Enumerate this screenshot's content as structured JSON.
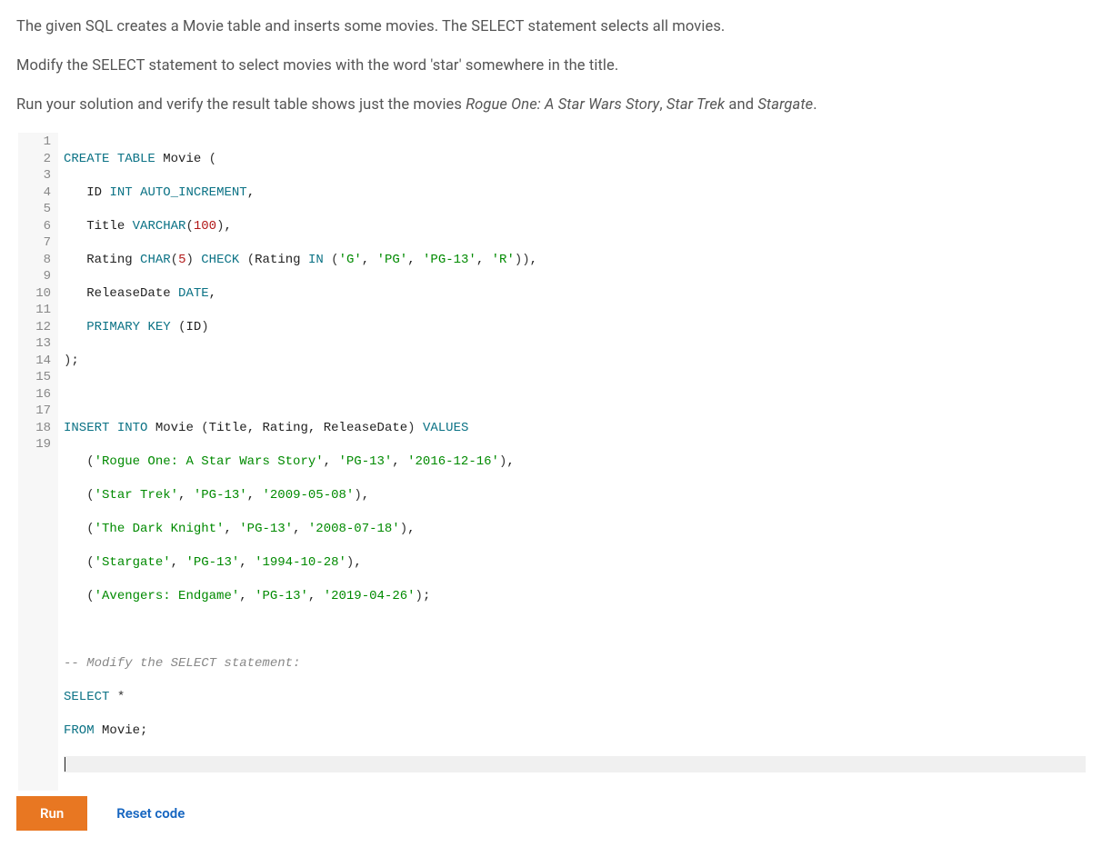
{
  "instructions": {
    "p1": "The given SQL creates a Movie table and inserts some movies. The SELECT statement selects all movies.",
    "p2": "Modify the SELECT statement to select movies with the word 'star' somewhere in the title.",
    "p3_pre": "Run your solution and verify the result table shows just the movies ",
    "p3_em1": "Rogue One: A Star Wars Story",
    "p3_sep1": ", ",
    "p3_em2": "Star Trek",
    "p3_sep2": " and ",
    "p3_em3": "Stargate",
    "p3_post": "."
  },
  "code": {
    "line_count": 19,
    "line1": {
      "kw_create": "CREATE",
      "kw_table": "TABLE",
      "ident": "Movie",
      "open": "("
    },
    "line2": {
      "ident": "ID",
      "type": "INT",
      "kw": "AUTO_INCREMENT",
      "comma": ","
    },
    "line3": {
      "ident": "Title",
      "type": "VARCHAR",
      "open": "(",
      "num": "100",
      "close": ")",
      "comma": ","
    },
    "line4": {
      "ident": "Rating",
      "type": "CHAR",
      "open": "(",
      "num": "5",
      "close": ")",
      "kw_check": "CHECK",
      "open2": "(",
      "ident2": "Rating",
      "kw_in": "IN",
      "open3": "(",
      "s1": "'G'",
      "c1": ",",
      "s2": "'PG'",
      "c2": ",",
      "s3": "'PG-13'",
      "c3": ",",
      "s4": "'R'",
      "close3": ")",
      "close2": ")",
      "comma": ","
    },
    "line5": {
      "ident": "ReleaseDate",
      "type": "DATE",
      "comma": ","
    },
    "line6": {
      "kw_primary": "PRIMARY",
      "kw_key": "KEY",
      "open": "(",
      "ident": "ID",
      "close": ")"
    },
    "line7": {
      "close": ")",
      "semi": ";"
    },
    "line9": {
      "kw_insert": "INSERT",
      "kw_into": "INTO",
      "ident": "Movie",
      "open": "(",
      "c1": "Title",
      "comma1": ",",
      "c2": "Rating",
      "comma2": ",",
      "c3": "ReleaseDate",
      "close": ")",
      "kw_values": "VALUES"
    },
    "line10": {
      "open": "(",
      "s1": "'Rogue One: A Star Wars Story'",
      "c1": ",",
      "s2": "'PG-13'",
      "c2": ",",
      "s3": "'2016-12-16'",
      "close": ")",
      "comma": ","
    },
    "line11": {
      "open": "(",
      "s1": "'Star Trek'",
      "c1": ",",
      "s2": "'PG-13'",
      "c2": ",",
      "s3": "'2009-05-08'",
      "close": ")",
      "comma": ","
    },
    "line12": {
      "open": "(",
      "s1": "'The Dark Knight'",
      "c1": ",",
      "s2": "'PG-13'",
      "c2": ",",
      "s3": "'2008-07-18'",
      "close": ")",
      "comma": ","
    },
    "line13": {
      "open": "(",
      "s1": "'Stargate'",
      "c1": ",",
      "s2": "'PG-13'",
      "c2": ",",
      "s3": "'1994-10-28'",
      "close": ")",
      "comma": ","
    },
    "line14": {
      "open": "(",
      "s1": "'Avengers: Endgame'",
      "c1": ",",
      "s2": "'PG-13'",
      "c2": ",",
      "s3": "'2019-04-26'",
      "close": ")",
      "semi": ";"
    },
    "line16": {
      "comment": "-- Modify the SELECT statement:"
    },
    "line17": {
      "kw_select": "SELECT",
      "star": "*"
    },
    "line18": {
      "kw_from": "FROM",
      "ident": "Movie",
      "semi": ";"
    }
  },
  "buttons": {
    "run": "Run",
    "reset": "Reset code"
  }
}
